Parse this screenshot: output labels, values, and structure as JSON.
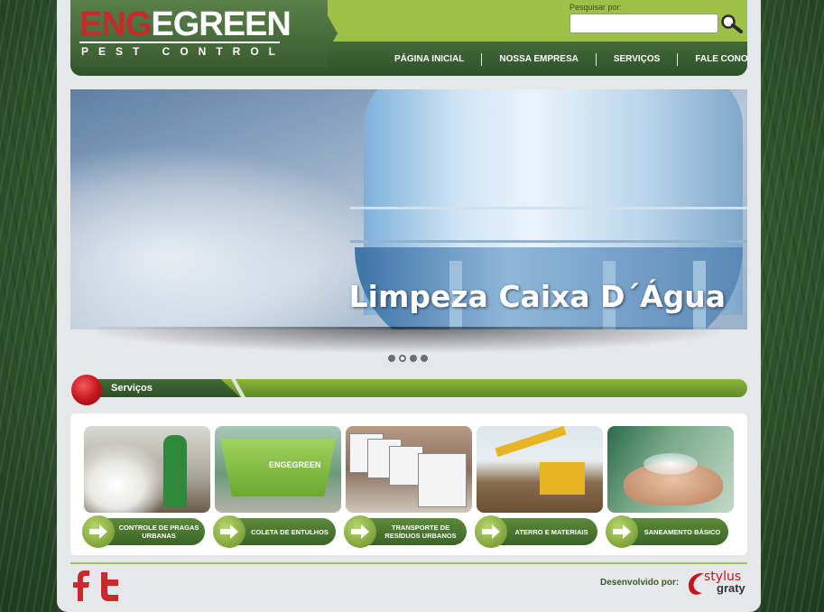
{
  "brand": {
    "eng": "ENG",
    "green": "EGREEN",
    "tagline": "PEST CONTROL"
  },
  "search": {
    "label": "Pesquisar por:",
    "value": "",
    "placeholder": ""
  },
  "nav": {
    "items": [
      {
        "label": "PÁGINA INICIAL"
      },
      {
        "label": "NOSSA EMPRESA"
      },
      {
        "label": "SERVIÇOS"
      },
      {
        "label": "FALE CONOSCO"
      }
    ]
  },
  "banner": {
    "caption": "Limpeza Caixa D´Água",
    "slides": 4,
    "active_slide": 2
  },
  "services": {
    "title": "Serviços",
    "items": [
      {
        "label": "CONTROLE DE PRAGAS URBANAS"
      },
      {
        "label": "COLETA DE ENTULHOS"
      },
      {
        "label": "TRANSPORTE DE RESÍDUOS URBANOS"
      },
      {
        "label": "ATERRO E MATERIAIS"
      },
      {
        "label": "SANEAMENTO BÁSICO"
      }
    ],
    "container_text": "ENGEGREEN"
  },
  "footer": {
    "developed_by": "Desenvolvido por:",
    "dev_logo_1": "stylus",
    "dev_logo_2": "graty"
  },
  "colors": {
    "accent_green": "#9cc145",
    "dark_green": "#3b5d32",
    "brand_red": "#c62a2a"
  }
}
